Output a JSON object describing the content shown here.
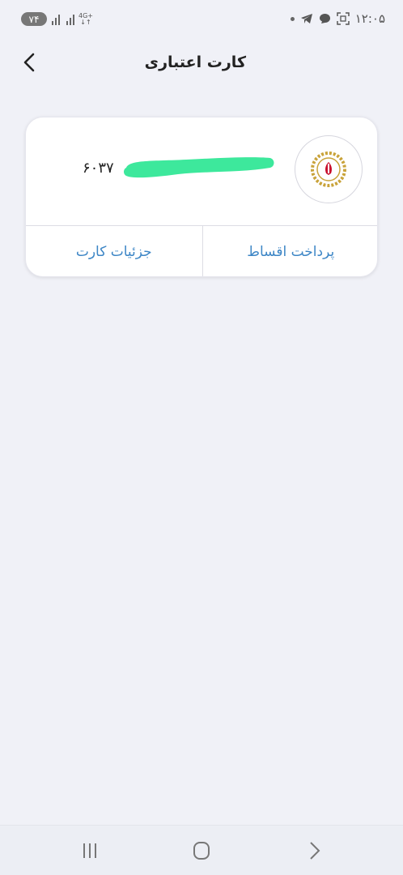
{
  "status_bar": {
    "battery": "۷۴",
    "network": "4G+",
    "time": "۱۲:۰۵",
    "icons": [
      "dot-icon",
      "telegram-icon",
      "message-icon",
      "screenshot-icon"
    ]
  },
  "header": {
    "title": "کارت اعتباری",
    "back_icon": "chevron-left-icon"
  },
  "card": {
    "bank_logo": "bank-melli-logo",
    "number_prefix": "۶۰۳۷",
    "number_redacted": true,
    "actions": {
      "installments": "پرداخت اقساط",
      "details": "جزئیات کارت"
    }
  },
  "colors": {
    "background": "#f0f1f7",
    "card": "#ffffff",
    "accent": "#3d86c6",
    "redaction": "#3de89c"
  },
  "nav_bar": {
    "buttons": [
      "recent-apps-icon",
      "home-icon",
      "back-icon"
    ]
  }
}
